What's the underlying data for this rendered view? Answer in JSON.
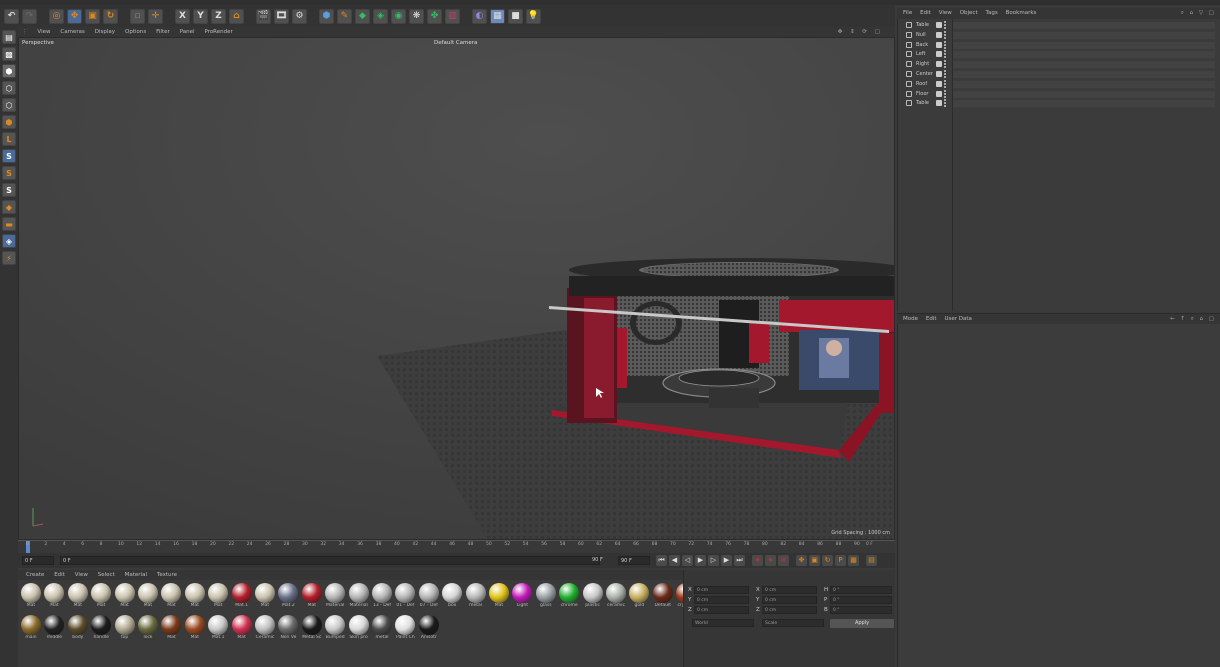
{
  "toolbar": {
    "axis_x": "X",
    "axis_y": "Y",
    "axis_z": "Z"
  },
  "left_tools": {
    "s1": "S",
    "s2": "S",
    "s3": "S"
  },
  "viewport": {
    "menu": [
      "View",
      "Cameras",
      "Display",
      "Options",
      "Filter",
      "Panel",
      "ProRender"
    ],
    "label": "Perspective",
    "camera": "Default Camera",
    "grid_spacing": "Grid Spacing : 1000 cm"
  },
  "timeline": {
    "ticks": [
      "0",
      "2",
      "4",
      "6",
      "8",
      "10",
      "12",
      "14",
      "16",
      "18",
      "20",
      "22",
      "24",
      "26",
      "28",
      "30",
      "32",
      "34",
      "36",
      "38",
      "40",
      "42",
      "44",
      "46",
      "48",
      "50",
      "52",
      "54",
      "56",
      "58",
      "60",
      "62",
      "64",
      "66",
      "68",
      "70",
      "72",
      "74",
      "76",
      "78",
      "80",
      "82",
      "84",
      "86",
      "88",
      "90"
    ],
    "end_label": "0 F",
    "start_field": "0 F",
    "min_field": "0 F",
    "max_field": "90 F",
    "end_field": "90 F"
  },
  "material_manager": {
    "menu": [
      "Create",
      "Edit",
      "View",
      "Select",
      "Material",
      "Texture"
    ],
    "materials": [
      {
        "name": "Mat",
        "color": "#c9c2ad"
      },
      {
        "name": "Mat",
        "color": "#c9c2ad"
      },
      {
        "name": "Mat",
        "color": "#c9c2ad"
      },
      {
        "name": "Mat",
        "color": "#c9c2ad"
      },
      {
        "name": "Mat",
        "color": "#c9c2ad"
      },
      {
        "name": "Mat",
        "color": "#c9c2ad"
      },
      {
        "name": "Mat",
        "color": "#c9c2ad"
      },
      {
        "name": "Mat",
        "color": "#c9c2ad"
      },
      {
        "name": "Mat",
        "color": "#c9c2ad"
      },
      {
        "name": "Mat.1",
        "color": "#b01e2a"
      },
      {
        "name": "Mat",
        "color": "#c9c2ad"
      },
      {
        "name": "Mat.2",
        "color": "#6a6f8a"
      },
      {
        "name": "Mat",
        "color": "#b01e2a"
      },
      {
        "name": "Material",
        "color": "#b5b5b5"
      },
      {
        "name": "Material",
        "color": "#b5b5b5"
      },
      {
        "name": "13 - Def",
        "color": "#b5b5b5"
      },
      {
        "name": "01 - Def",
        "color": "#b5b5b5"
      },
      {
        "name": "07 - Def",
        "color": "#b5b5b5"
      },
      {
        "name": "box",
        "color": "#d5d5d5"
      },
      {
        "name": "metal",
        "color": "#b8b8b8"
      },
      {
        "name": "Mat",
        "color": "#e0c21a"
      },
      {
        "name": "Light",
        "color": "#c21ab8"
      },
      {
        "name": "glass",
        "color": "#9aa0a4"
      },
      {
        "name": "chrome",
        "color": "#20b030"
      },
      {
        "name": "plastic",
        "color": "#c8c8c8"
      },
      {
        "name": "ceramic",
        "color": "#aab0aa"
      },
      {
        "name": "gold",
        "color": "#c8b060"
      },
      {
        "name": "Default",
        "color": "#6a2a18"
      },
      {
        "name": "crystals",
        "color": "#a03a1a"
      },
      {
        "name": "main",
        "color": "#8a6a2a"
      },
      {
        "name": "middle",
        "color": "#222222"
      },
      {
        "name": "body",
        "color": "#5a4a2a"
      },
      {
        "name": "handle",
        "color": "#1c1c1c"
      },
      {
        "name": "top",
        "color": "#b0a890"
      },
      {
        "name": "lock",
        "color": "#6a6a40"
      },
      {
        "name": "Mat",
        "color": "#7a3a1a"
      },
      {
        "name": "Mat",
        "color": "#9a4a20"
      },
      {
        "name": "Mat.1",
        "color": "#c8c8c8"
      },
      {
        "name": "Mat",
        "color": "#d03050"
      },
      {
        "name": "Ceramic",
        "color": "#c0c0c0"
      },
      {
        "name": "Non Ve",
        "color": "#6a6a6a"
      },
      {
        "name": "Metal Sc",
        "color": "#1a1a1a"
      },
      {
        "name": "Bumped",
        "color": "#c8c8c8"
      },
      {
        "name": "Skin pro",
        "color": "#d8d8d8"
      },
      {
        "name": "metal",
        "color": "#4a4a4a"
      },
      {
        "name": "Paint Ch",
        "color": "#e0e0e0"
      },
      {
        "name": "Anisotr",
        "color": "#1a1a1a"
      }
    ]
  },
  "coordinates": {
    "col1": [
      "X",
      "Y",
      "Z"
    ],
    "col2": [
      "X",
      "Y",
      "Z"
    ],
    "col3": [
      "H",
      "P",
      "B"
    ],
    "values": "0 cm",
    "angle_values": "0 °",
    "mode_select": "World",
    "size_select": "Scale",
    "apply_label": "Apply"
  },
  "object_manager": {
    "menu": [
      "File",
      "Edit",
      "View",
      "Object",
      "Tags",
      "Bookmarks"
    ],
    "objects": [
      "Table",
      "Null",
      "Back",
      "Left",
      "Right",
      "Center",
      "Roof",
      "Floor",
      "Table"
    ]
  },
  "attribute_manager": {
    "menu": [
      "Mode",
      "Edit",
      "User Data"
    ]
  },
  "colors": {
    "accent_orange": "#e08a1c",
    "stage_red": "#a3182c",
    "viewport_bg": "#454545"
  }
}
